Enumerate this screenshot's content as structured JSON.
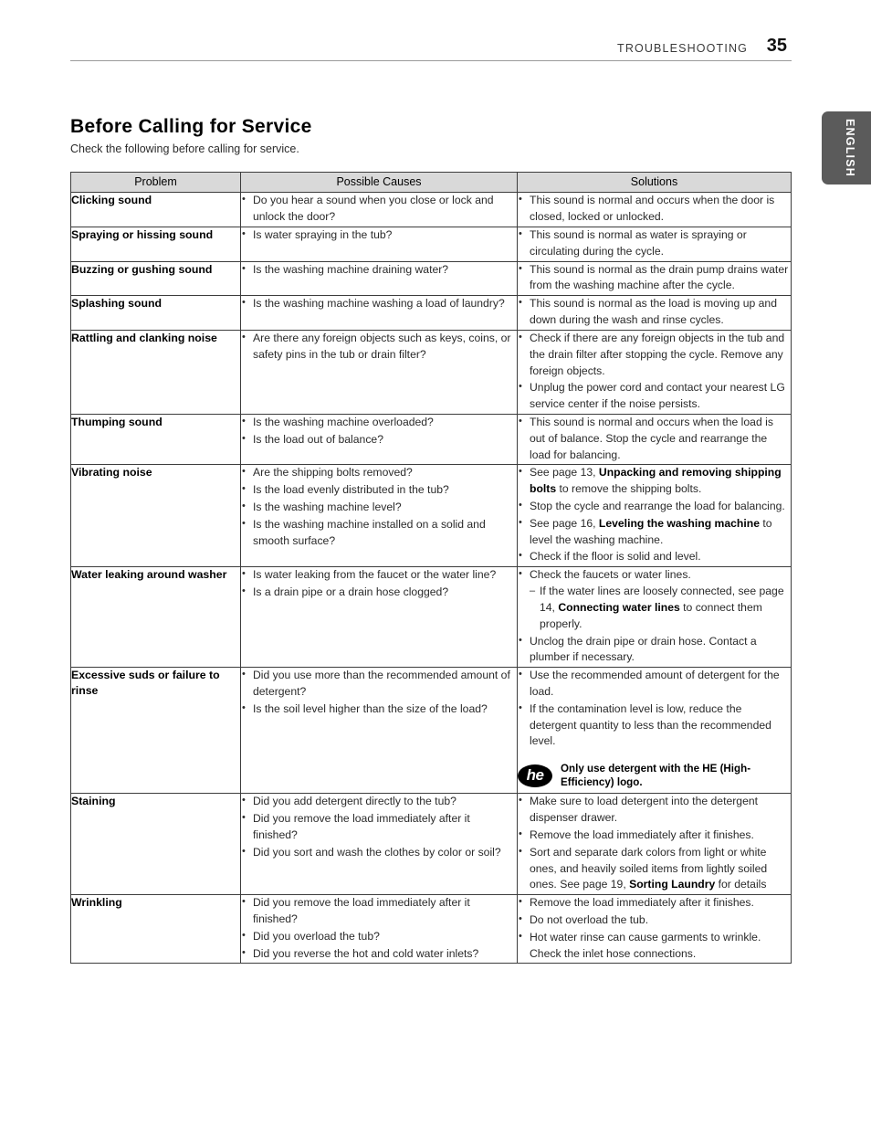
{
  "header": {
    "chapter": "TROUBLESHOOTING",
    "page_number": "35"
  },
  "side_tab": {
    "label": "ENGLISH"
  },
  "section": {
    "title": "Before Calling for Service",
    "intro": "Check the following before calling for service."
  },
  "table": {
    "columns": [
      "Problem",
      "Possible Causes",
      "Solutions"
    ],
    "rows": [
      {
        "problem": "Clicking sound",
        "causes": [
          "Do you hear a sound when you close or lock and unlock the door?"
        ],
        "solutions": [
          "This sound is normal and occurs when the door is closed, locked or unlocked."
        ]
      },
      {
        "problem": "Spraying or hissing sound",
        "causes": [
          "Is water spraying in the tub?"
        ],
        "solutions": [
          "This sound is normal as water is spraying or circulating during the cycle."
        ]
      },
      {
        "problem": "Buzzing or gushing sound",
        "causes": [
          "Is the washing machine draining water?"
        ],
        "solutions": [
          "This sound is normal as the drain pump drains water from the washing machine after the cycle."
        ]
      },
      {
        "problem": "Splashing sound",
        "causes": [
          "Is the washing machine washing a load of laundry?"
        ],
        "solutions": [
          "This sound is normal as the load is moving up and down during the wash and rinse cycles."
        ]
      },
      {
        "problem": "Rattling and clanking noise",
        "causes": [
          "Are there any foreign objects such as keys, coins, or safety pins in the tub or drain filter?"
        ],
        "solutions": [
          "Check if there are any foreign objects in the tub and the drain filter after stopping the cycle. Remove any foreign objects.",
          "Unplug the power cord and contact your nearest LG service center if the noise persists."
        ]
      },
      {
        "problem": "Thumping sound",
        "causes": [
          "Is the washing machine overloaded?",
          "Is the load out of balance?"
        ],
        "solutions": [
          "This sound is normal and occurs when the load is out of balance. Stop the cycle and rearrange the load for balancing."
        ]
      },
      {
        "problem": "Vibrating noise",
        "causes": [
          "Are the shipping bolts removed?",
          "Is the load evenly distributed in the tub?",
          "Is the washing machine level?",
          "Is the washing machine installed on a solid and smooth surface?"
        ],
        "solutions_rich": [
          {
            "pre": "See page 13, ",
            "bold": "Unpacking and removing shipping bolts",
            "post": " to remove the shipping bolts."
          },
          {
            "pre": "Stop the cycle and rearrange the load for balancing.",
            "bold": "",
            "post": ""
          },
          {
            "pre": "See page 16, ",
            "bold": "Leveling the washing machine",
            "post": " to level the washing machine."
          },
          {
            "pre": "Check if the floor is solid and level.",
            "bold": "",
            "post": ""
          }
        ]
      },
      {
        "problem": "Water leaking around washer",
        "causes": [
          "Is water leaking from the faucet or the water line?",
          "Is a drain pipe or a drain hose clogged?"
        ],
        "solutions_rich": [
          {
            "pre": "Check the faucets or water lines.",
            "bold": "",
            "post": "",
            "sub": [
              {
                "pre": "If the water lines are loosely connected, see page 14, ",
                "bold": "Connecting water lines",
                "post": " to connect them properly."
              }
            ]
          },
          {
            "pre": "Unclog the drain pipe or drain hose. Contact a plumber if necessary.",
            "bold": "",
            "post": ""
          }
        ]
      },
      {
        "problem": "Excessive suds or failure to rinse",
        "causes": [
          "Did you use more than the recommended amount of detergent?",
          "Is the soil level higher than the size of the load?"
        ],
        "solutions": [
          "Use the recommended amount of detergent for the load.",
          "If the contamination level is low, reduce the detergent quantity to less than the recommended level."
        ],
        "note": {
          "logo_text": "he",
          "text": "Only use detergent with the HE (High-Efficiency) logo."
        }
      },
      {
        "problem": "Staining",
        "causes": [
          "Did you add detergent directly to the tub?",
          "Did you remove the load immediately after it finished?",
          "Did you sort and wash the clothes by color or soil?"
        ],
        "solutions_rich": [
          {
            "pre": "Make sure to load detergent into the detergent dispenser drawer.",
            "bold": "",
            "post": ""
          },
          {
            "pre": "Remove the load immediately after it finishes.",
            "bold": "",
            "post": ""
          },
          {
            "pre": "Sort and separate dark colors from light or white ones, and heavily soiled items from lightly soiled ones. See page 19, ",
            "bold": "Sorting Laundry",
            "post": " for details"
          }
        ]
      },
      {
        "problem": "Wrinkling",
        "causes": [
          "Did you remove the load immediately after it finished?",
          "Did you overload the tub?",
          "Did you reverse the hot and cold water inlets?"
        ],
        "solutions": [
          "Remove the load immediately after it finishes.",
          "Do not overload the tub.",
          "Hot water rinse can cause garments to wrinkle. Check the inlet hose connections."
        ]
      }
    ]
  }
}
